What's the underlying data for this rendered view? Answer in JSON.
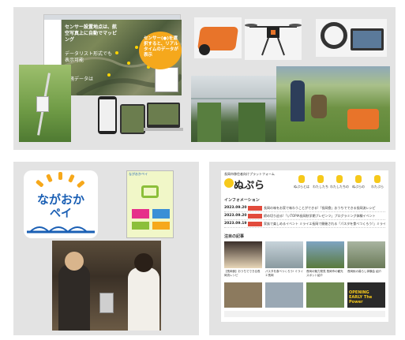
{
  "panel_agri": {
    "screen_title": "センサー設置地点は、航空写真上に自動でマッピング",
    "screen_sub": "データリスト形式でも表示可能",
    "screen_note": "業務データは",
    "bubble": "センサー(●)を選択すると、リアルタイムのデータが表示"
  },
  "panel_pay": {
    "app_icon_line1": "ながおか",
    "app_icon_line2": "ペイ",
    "phone_brand": "ながおかペイ"
  },
  "panel_web": {
    "site_tagline": "長岡市移住者向けプラットフォーム",
    "site_logo": "ぬぷら",
    "nav": [
      "ぬぷらとは",
      "わたしたち",
      "わたしたちの",
      "ぬぷらの",
      "わたぷら"
    ],
    "info_heading": "インフォメーション",
    "news": [
      {
        "date": "2023.09.20",
        "tag": "長岡のハナ",
        "text": "長岡の味をお家で味わうことができる!「長岡食」おうちでできる長岡流レシピ"
      },
      {
        "date": "2023.09.20",
        "tag": "長岡のハナ",
        "text": "締め切り迫る!「いTOPIA長岡秋学期ブレゼンツ」プログラミング体験イベント"
      },
      {
        "date": "2023.09.19",
        "tag": "長岡のハナ",
        "text": "家族で楽しめるイベント ミライエ長岡で開催される「パスタを食べつくろう!」ミライエ長岡"
      }
    ],
    "section_heading": "注目の記事",
    "cards": [
      "【長岡食】おうちでできる長岡流レシピ",
      "パスタを食べつくろう! ミライエ長岡",
      "長岡の魅力発見 長岡市の観光スポット紹介",
      "長岡秋の暮らし体験会 紹介"
    ],
    "banner": "OPENING EARLY The Power"
  }
}
